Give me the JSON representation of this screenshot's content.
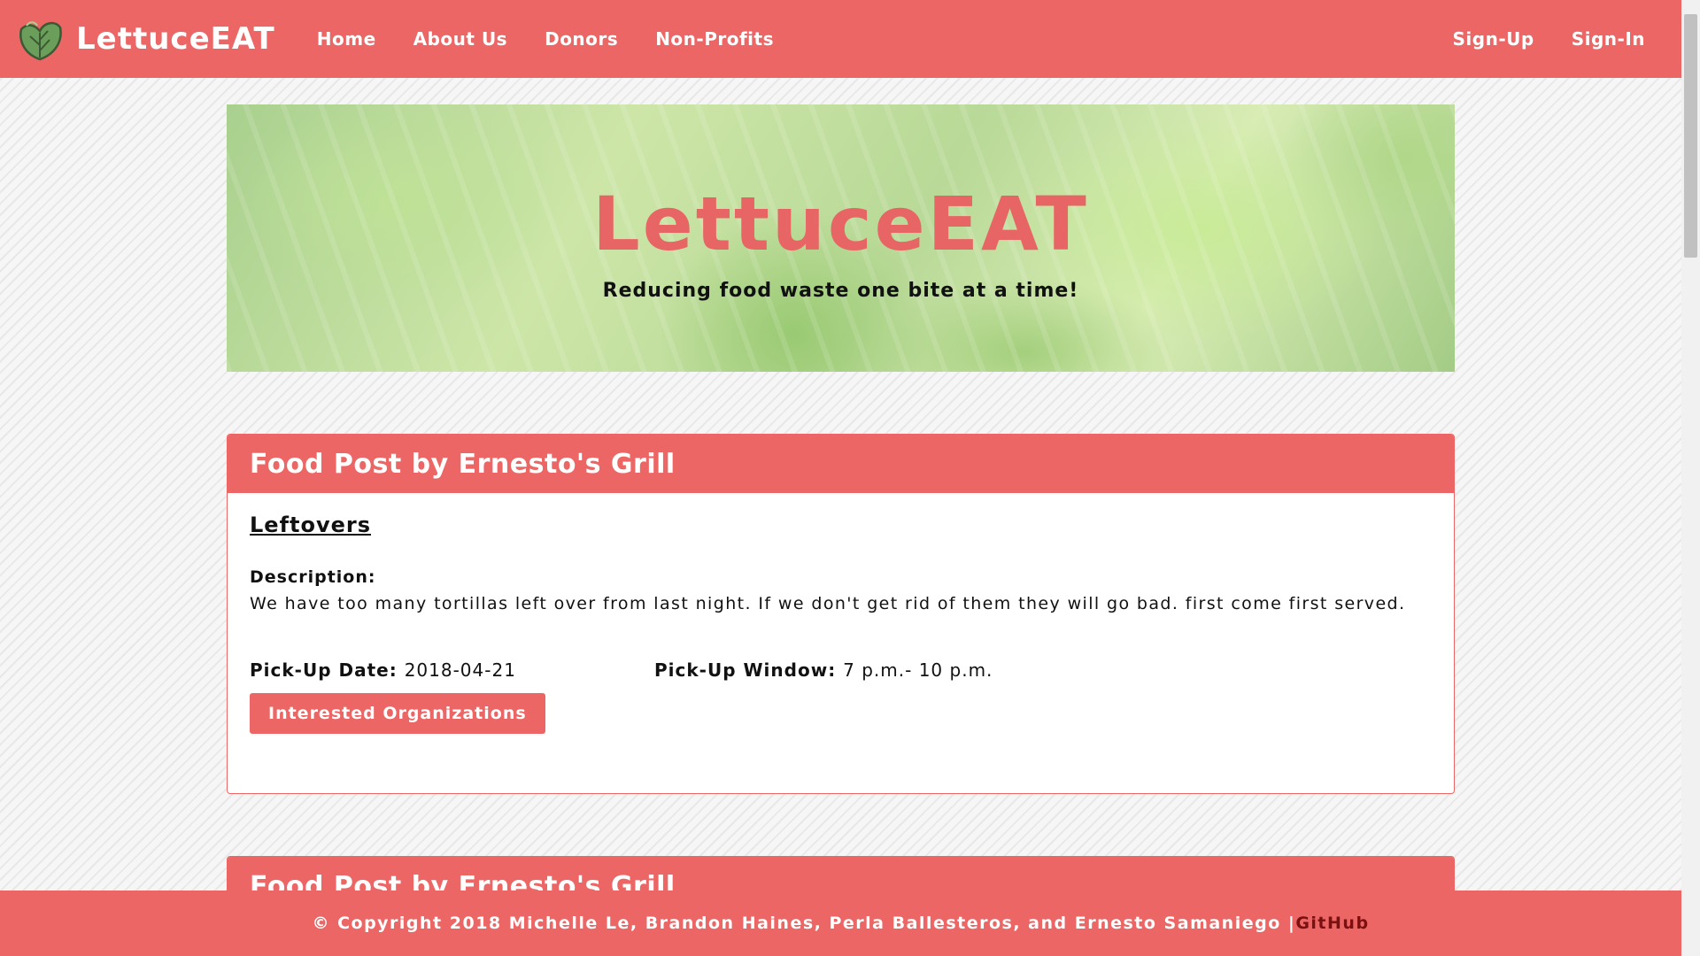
{
  "brand": {
    "name": "LettuceEAT",
    "logo_icon": "lettuce-leaf-icon"
  },
  "nav": {
    "left": [
      "Home",
      "About Us",
      "Donors",
      "Non-Profits"
    ],
    "right": [
      "Sign-Up",
      "Sign-In"
    ]
  },
  "hero": {
    "title": "LettuceEAT",
    "tagline": "Reducing food waste one bite at a time!"
  },
  "posts": [
    {
      "header": "Food Post by Ernesto's Grill",
      "title": "Leftovers",
      "description_label": "Description:",
      "description": "We have too many tortillas left over from last night. If we don't get rid of them they will go bad. first come first served.",
      "pickup_date_label": "Pick-Up Date",
      "pickup_date": "2018-04-21",
      "pickup_window_label": "Pick-Up Window",
      "pickup_window": "7 p.m.- 10 p.m.",
      "button_label": "Interested Organizations"
    },
    {
      "header": "Food Post by Ernesto's Grill"
    }
  ],
  "footer": {
    "copyright": "© Copyright 2018 Michelle Le, Brandon Haines, Perla Ballesteros, and Ernesto Samaniego |",
    "link": "GitHub"
  },
  "colors": {
    "accent": "#ec6665",
    "footer_link": "#7a1010"
  }
}
